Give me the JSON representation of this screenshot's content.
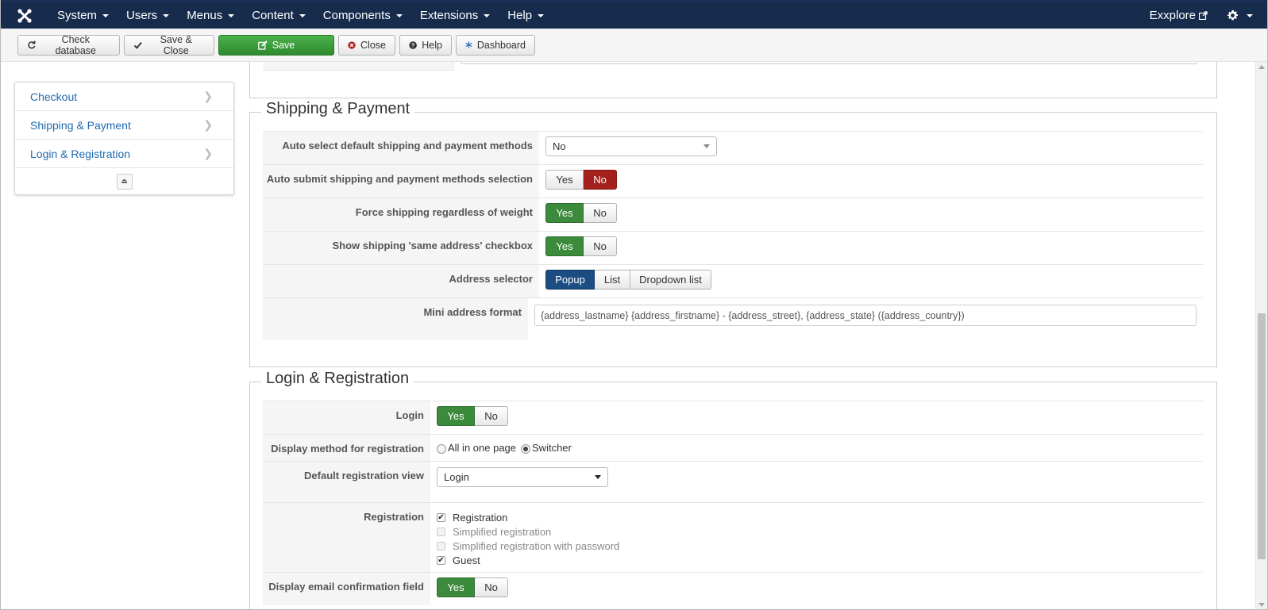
{
  "nav": {
    "logo_icon": "joomla-logo-icon",
    "items": [
      {
        "label": "System"
      },
      {
        "label": "Users"
      },
      {
        "label": "Menus"
      },
      {
        "label": "Content"
      },
      {
        "label": "Components"
      },
      {
        "label": "Extensions"
      },
      {
        "label": "Help"
      }
    ],
    "explore_label": "Exxplore",
    "explore_icon": "external-link-icon",
    "settings_icon": "gear-icon",
    "bar_color": "#172b4d"
  },
  "toolbar": {
    "check_db": "Check database",
    "save_close": "Save & Close",
    "save": "Save",
    "close": "Close",
    "help": "Help",
    "dashboard": "Dashboard",
    "save_color": "#3c963c"
  },
  "sidebar": {
    "items": [
      {
        "label": "Checkout"
      },
      {
        "label": "Shipping & Payment"
      },
      {
        "label": "Login & Registration"
      }
    ],
    "collapse_icon": "eject-icon"
  },
  "shipping": {
    "legend": "Shipping & Payment",
    "auto_select": {
      "label": "Auto select default shipping and payment methods",
      "value": "No"
    },
    "auto_submit": {
      "label": "Auto submit shipping and payment methods selection",
      "yes": "Yes",
      "no": "No",
      "selected": "No"
    },
    "force_shipping": {
      "label": "Force shipping regardless of weight",
      "yes": "Yes",
      "no": "No",
      "selected": "Yes"
    },
    "same_address": {
      "label": "Show shipping 'same address' checkbox",
      "yes": "Yes",
      "no": "No",
      "selected": "Yes"
    },
    "address_selector": {
      "label": "Address selector",
      "options": [
        "Popup",
        "List",
        "Dropdown list"
      ],
      "selected": "Popup"
    },
    "mini_format": {
      "label": "Mini address format",
      "value": "{address_lastname} {address_firstname} - {address_street}, {address_state} ({address_country})"
    }
  },
  "login": {
    "legend": "Login & Registration",
    "login": {
      "label": "Login",
      "yes": "Yes",
      "no": "No",
      "selected": "Yes"
    },
    "display_method": {
      "label": "Display method for registration",
      "options": [
        "All in one page",
        "Switcher"
      ],
      "selected": "Switcher"
    },
    "default_view": {
      "label": "Default registration view",
      "value": "Login"
    },
    "registration": {
      "label": "Registration",
      "options": [
        {
          "label": "Registration",
          "checked": true,
          "disabled": false
        },
        {
          "label": "Simplified registration",
          "checked": false,
          "disabled": true
        },
        {
          "label": "Simplified registration with password",
          "checked": false,
          "disabled": true
        },
        {
          "label": "Guest",
          "checked": true,
          "disabled": false
        }
      ]
    },
    "email_confirm": {
      "label": "Display email confirmation field",
      "yes": "Yes",
      "no": "No",
      "selected": "Yes"
    }
  },
  "colors": {
    "yes_active": "#3c8a3c",
    "no_active": "#a4201c",
    "popup_active": "#1b4d82",
    "link": "#1f6bb0"
  }
}
